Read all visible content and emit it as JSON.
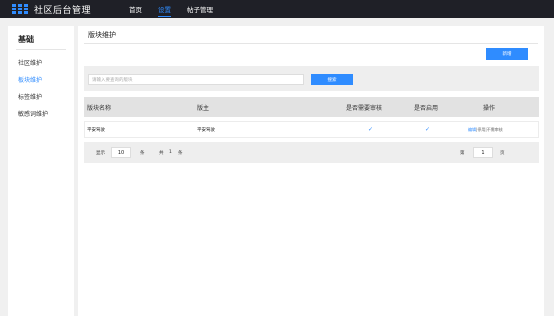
{
  "app": {
    "title": "社区后台管理"
  },
  "nav": {
    "items": [
      {
        "label": "首页"
      },
      {
        "label": "设置"
      },
      {
        "label": "帖子管理"
      }
    ]
  },
  "sidebar": {
    "title": "基础",
    "items": [
      {
        "label": "社区维护"
      },
      {
        "label": "板块维护"
      },
      {
        "label": "标签维护"
      },
      {
        "label": "敏感词维护"
      }
    ]
  },
  "main": {
    "tab_label": "版块维护",
    "add_label": "新增",
    "search": {
      "placeholder": "请输入要查询的版块",
      "button_label": "搜索"
    },
    "columns": [
      "版块名称",
      "版主",
      "是否需要审核",
      "是否启用",
      "操作"
    ],
    "rows": [
      {
        "name": "平安驾驶",
        "moderator": "平安驾驶",
        "needs_review": "✓",
        "enabled": "✓",
        "actions": {
          "edit": "编辑",
          "separator1": " | ",
          "disable": "停用",
          "separator2": " | ",
          "no_review": "不需审核"
        }
      }
    ],
    "pager": {
      "show_label": "显示",
      "page_size": "10",
      "items_label": "条",
      "total_label": "共",
      "total": "1",
      "total_unit": "条",
      "page_prefix": "第",
      "page": "1",
      "page_unit": "页"
    }
  },
  "colors": {
    "accent": "#2f8cff",
    "topbar": "#1f2027"
  }
}
